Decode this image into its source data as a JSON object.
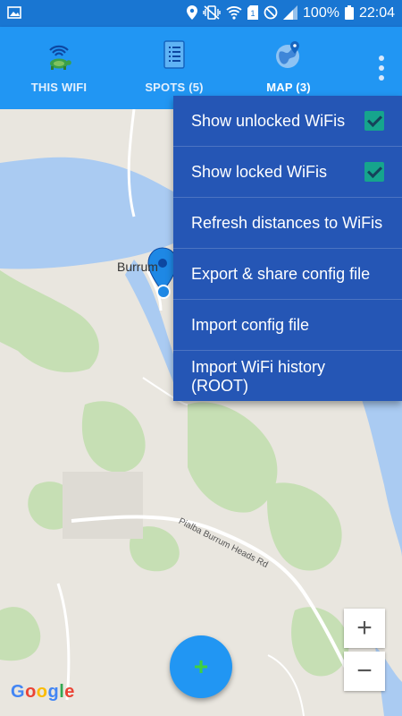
{
  "status_bar": {
    "battery": "100%",
    "time": "22:04",
    "icons": [
      "image-icon",
      "location-icon",
      "vibrate-icon",
      "wifi-icon",
      "sim-icon",
      "block-icon",
      "signal-icon",
      "battery-icon"
    ]
  },
  "tabs": [
    {
      "label": "THIS WIFI",
      "icon": "wifi-turtle-icon",
      "active": false
    },
    {
      "label": "SPOTS (5)",
      "icon": "list-icon",
      "active": false
    },
    {
      "label": "MAP (3)",
      "icon": "globe-pin-icon",
      "active": true
    }
  ],
  "menu": {
    "items": [
      {
        "label": "Show unlocked WiFis",
        "checked": true
      },
      {
        "label": "Show locked WiFis",
        "checked": true
      },
      {
        "label": "Refresh distances to WiFis"
      },
      {
        "label": "Export & share config file"
      },
      {
        "label": "Import config file"
      },
      {
        "label": "Import WiFi history (ROOT)"
      }
    ]
  },
  "map": {
    "place_label": "Burrum",
    "road_label": "Pialba Burrum Heads Rd",
    "attribution": "Google",
    "zoom_in": "+",
    "zoom_out": "−"
  },
  "fab": {
    "label": "+"
  },
  "colors": {
    "appbar": "#2196f3",
    "statusbar": "#1976d2",
    "menu": "#2556b5",
    "checkbox": "#16a58d",
    "water": "#aacbf2",
    "land": "#e9e6df",
    "park": "#c6dfb4"
  }
}
